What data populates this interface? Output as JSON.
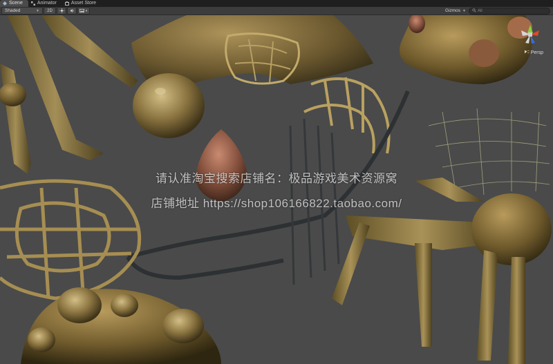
{
  "tabs": [
    {
      "label": "Scene",
      "icon": "scene-icon",
      "active": true
    },
    {
      "label": "Animator",
      "icon": "animator-icon",
      "active": false
    },
    {
      "label": "Asset Store",
      "icon": "asset-store-icon",
      "active": false
    }
  ],
  "toolbar": {
    "shading_mode": "Shaded",
    "mode_2d": "2D",
    "gizmos_label": "Gizmos",
    "search_placeholder": "All"
  },
  "viewport": {
    "projection_label": "Persp"
  },
  "watermark": {
    "line1": "请认准淘宝搜索店铺名：极品游戏美术资源窝",
    "line2": "店铺地址 https://shop106166822.taobao.com/"
  },
  "colors": {
    "background": "#474747",
    "tab_bar": "#1f1f1f",
    "toolbar": "#3c3c3c"
  }
}
